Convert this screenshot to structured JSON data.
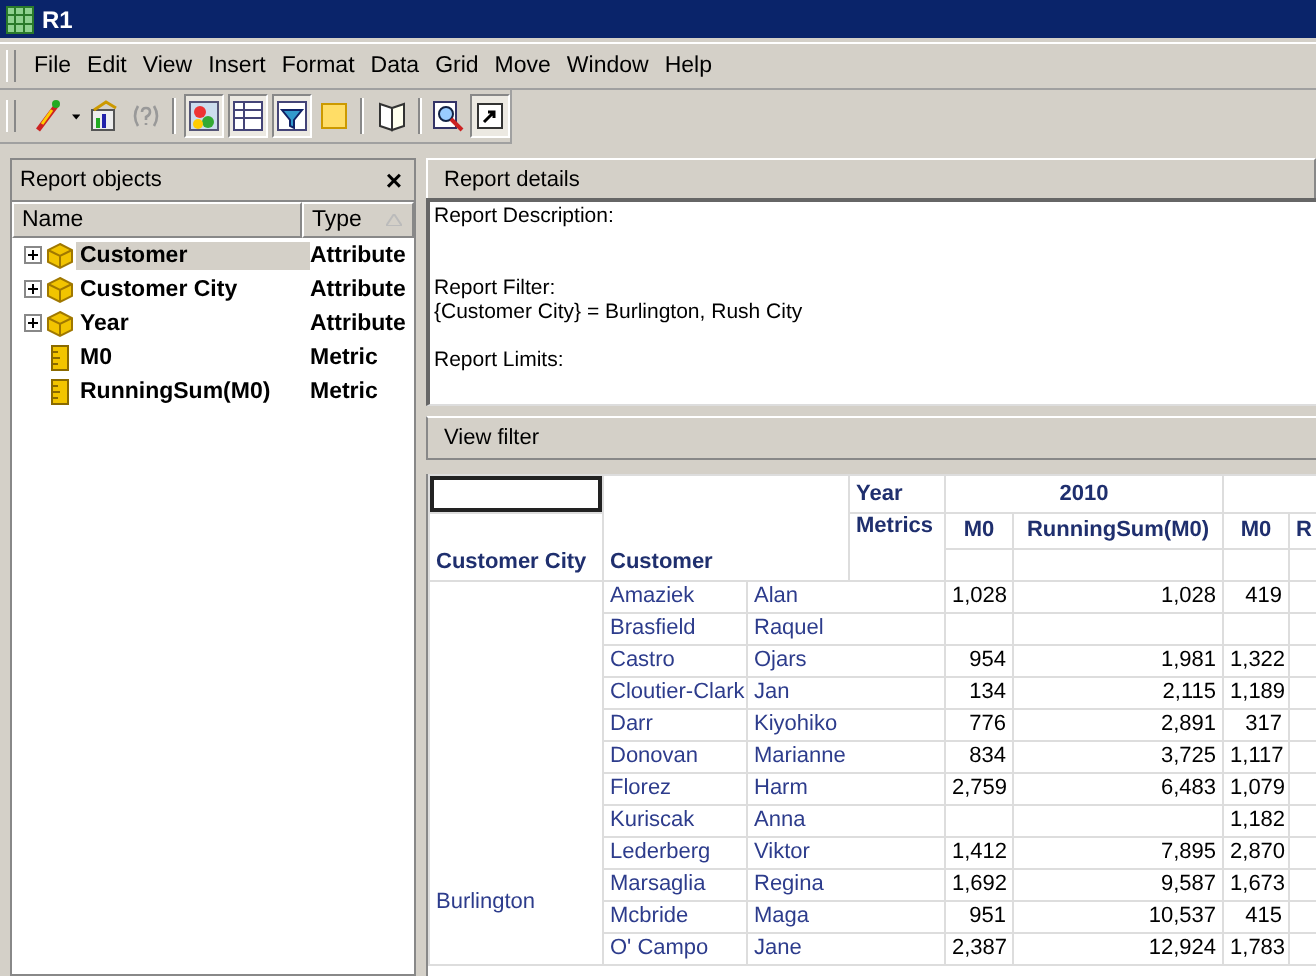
{
  "window": {
    "title": "R1"
  },
  "menu": [
    "File",
    "Edit",
    "View",
    "Insert",
    "Format",
    "Data",
    "Grid",
    "Move",
    "Window",
    "Help"
  ],
  "toolbar": [
    {
      "buttons": [
        {
          "kind": "wand"
        },
        {
          "kind": "caret"
        },
        {
          "kind": "chart"
        },
        {
          "kind": "help"
        }
      ]
    },
    {
      "buttons": [
        {
          "kind": "grid-graph",
          "pressed": true
        },
        {
          "kind": "table",
          "pressed": true
        },
        {
          "kind": "filter",
          "pressed": true
        },
        {
          "kind": "note",
          "pressed": false
        }
      ]
    },
    {
      "buttons": [
        {
          "kind": "book",
          "pressed": false
        }
      ]
    },
    {
      "buttons": [
        {
          "kind": "zoom",
          "pressed": false
        },
        {
          "kind": "shortcut",
          "pressed": true
        }
      ]
    }
  ],
  "report_objects": {
    "title": "Report objects",
    "close": "×",
    "columns": [
      "Name",
      "Type"
    ],
    "items": [
      {
        "name": "Customer",
        "type": "Attribute",
        "kind": "attribute",
        "expanded": false,
        "selected": true
      },
      {
        "name": "Customer City",
        "type": "Attribute",
        "kind": "attribute",
        "expanded": false,
        "selected": false
      },
      {
        "name": "Year",
        "type": "Attribute",
        "kind": "attribute",
        "expanded": false,
        "selected": false
      },
      {
        "name": "M0",
        "type": "Metric",
        "kind": "metric",
        "selected": false
      },
      {
        "name": "RunningSum(M0)",
        "type": "Metric",
        "kind": "metric",
        "selected": false
      }
    ]
  },
  "report_details": {
    "title": "Report details",
    "description_label": "Report Description:",
    "filter_label": "Report Filter:",
    "filter": "{Customer City} = Burlington, Rush City",
    "limits_label": "Report Limits:"
  },
  "view_filter": {
    "title": "View filter"
  },
  "grid": {
    "row_headers": [
      "Customer City",
      "Customer"
    ],
    "year_label": "Year",
    "metrics_label": "Metrics",
    "year": "2010",
    "metrics": [
      "M0",
      "RunningSum(M0)",
      "M0",
      "R"
    ],
    "city": "Burlington",
    "rows": [
      {
        "last": "Amaziek",
        "first": "Alan",
        "m0_2010": "1,028",
        "running_sum_2010": "1,028",
        "m0_next": "419"
      },
      {
        "last": "Brasfield",
        "first": "Raquel"
      },
      {
        "last": "Castro",
        "first": "Ojars",
        "m0_2010": "954",
        "running_sum_2010": "1,981",
        "m0_next": "1,322"
      },
      {
        "last": "Cloutier-Clark",
        "first": "Jan",
        "m0_2010": "134",
        "running_sum_2010": "2,115",
        "m0_next": "1,189"
      },
      {
        "last": "Darr",
        "first": "Kiyohiko",
        "m0_2010": "776",
        "running_sum_2010": "2,891",
        "m0_next": "317"
      },
      {
        "last": "Donovan",
        "first": "Marianne",
        "m0_2010": "834",
        "running_sum_2010": "3,725",
        "m0_next": "1,117"
      },
      {
        "last": "Florez",
        "first": "Harm",
        "m0_2010": "2,759",
        "running_sum_2010": "6,483",
        "m0_next": "1,079"
      },
      {
        "last": "Kuriscak",
        "first": "Anna",
        "m0_next": "1,182"
      },
      {
        "last": "Lederberg",
        "first": "Viktor",
        "m0_2010": "1,412",
        "running_sum_2010": "7,895",
        "m0_next": "2,870"
      },
      {
        "last": "Marsaglia",
        "first": "Regina",
        "m0_2010": "1,692",
        "running_sum_2010": "9,587",
        "m0_next": "1,673"
      },
      {
        "last": "Mcbride",
        "first": "Maga",
        "m0_2010": "951",
        "running_sum_2010": "10,537",
        "m0_next": "415"
      },
      {
        "last": "O' Campo",
        "first": "Jane",
        "m0_2010": "2,387",
        "running_sum_2010": "12,924",
        "m0_next": "1,783"
      }
    ]
  }
}
